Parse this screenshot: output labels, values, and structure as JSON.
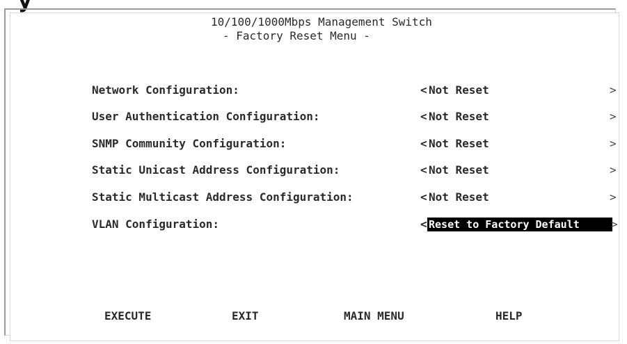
{
  "header": {
    "title": "10/100/1000Mbps Management Switch",
    "subtitle": "- Factory Reset Menu -"
  },
  "rows": [
    {
      "label": "Network Configuration:",
      "value": "Not Reset"
    },
    {
      "label": "User Authentication Configuration:",
      "value": "Not Reset"
    },
    {
      "label": "SNMP Community Configuration:",
      "value": "Not Reset"
    },
    {
      "label": "Static Unicast Address Configuration:",
      "value": "Not Reset"
    },
    {
      "label": "Static Multicast Address Configuration:",
      "value": "Not Reset"
    },
    {
      "label": "VLAN Configuration:",
      "value": "Reset to Factory Default"
    }
  ],
  "bracket_open": "<",
  "bracket_close": ">",
  "actions": {
    "execute": "EXECUTE",
    "exit": "EXIT",
    "main_menu": "MAIN MENU",
    "help": "HELP"
  }
}
